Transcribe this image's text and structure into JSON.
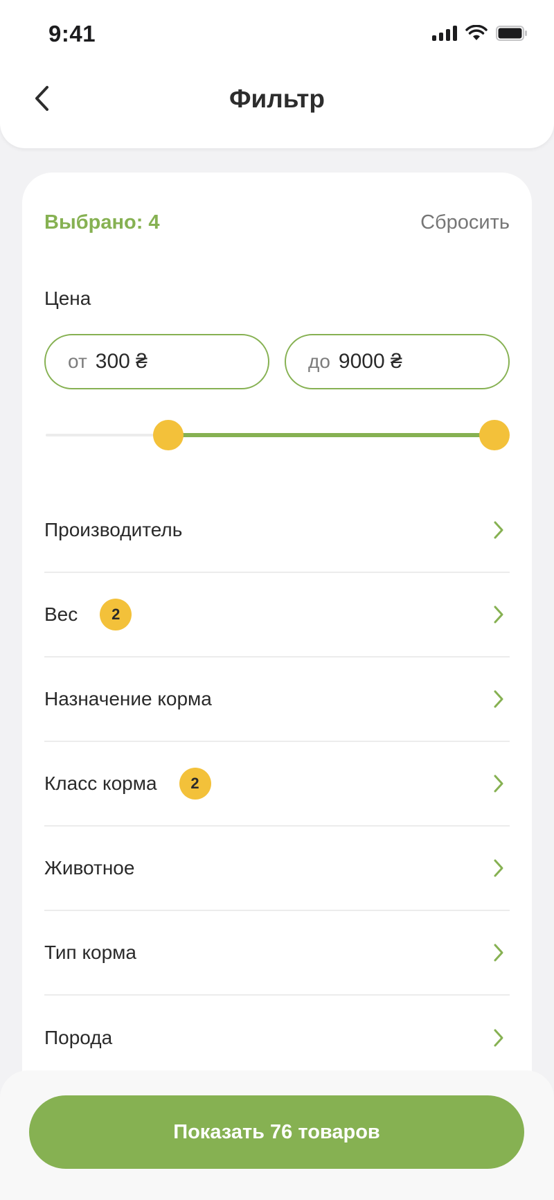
{
  "status_bar": {
    "time": "9:41"
  },
  "header": {
    "title": "Фильтр"
  },
  "filter": {
    "selected_label": "Выбрано: 4",
    "reset_label": "Сбросить",
    "price": {
      "label": "Цена",
      "from_prefix": "от",
      "from_value": "300 ₴",
      "to_prefix": "до",
      "to_value": "9000 ₴",
      "slider_low_fraction": 0.25,
      "slider_high_fraction": 1.0
    },
    "items": [
      {
        "label": "Производитель",
        "badge": null
      },
      {
        "label": "Вес",
        "badge": "2"
      },
      {
        "label": "Назначение корма",
        "badge": null
      },
      {
        "label": "Класс корма",
        "badge": "2"
      },
      {
        "label": "Животное",
        "badge": null
      },
      {
        "label": "Тип корма",
        "badge": null
      },
      {
        "label": "Порода",
        "badge": null
      }
    ]
  },
  "footer": {
    "show_button_label": "Показать 76 товаров"
  },
  "colors": {
    "accent": "#86b152",
    "badge": "#f3c13a",
    "muted": "#767676"
  },
  "icons": {
    "back": "chevron-left-icon",
    "row_arrow": "chevron-right-icon"
  }
}
